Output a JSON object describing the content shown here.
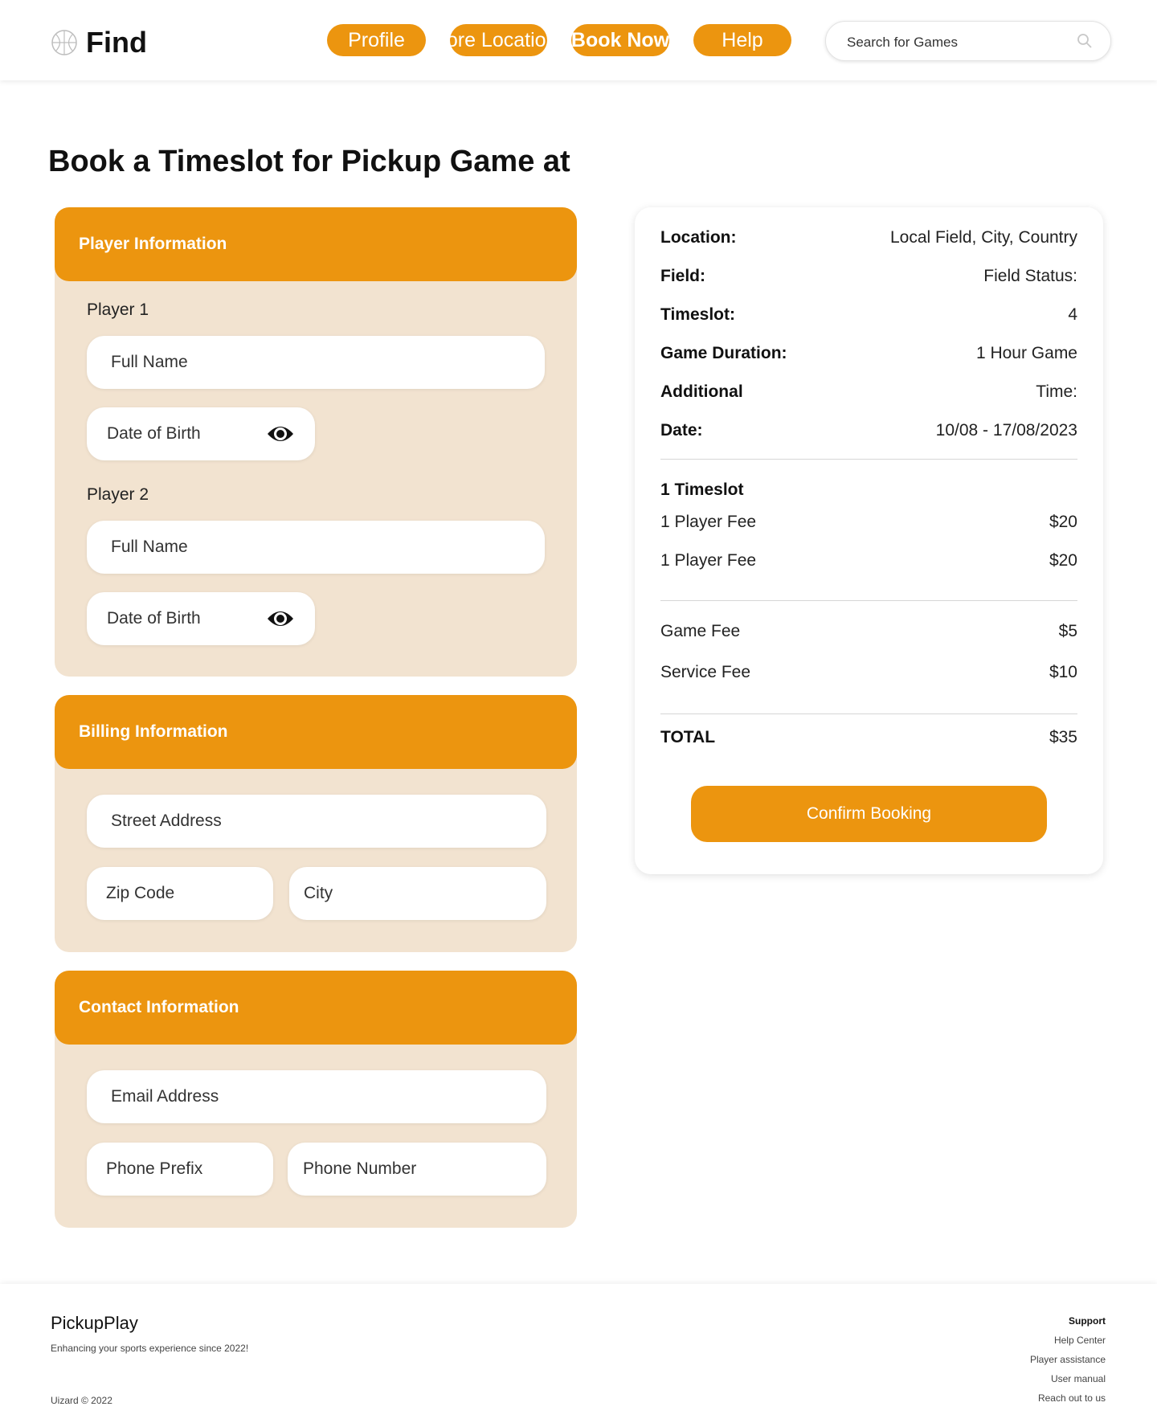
{
  "header": {
    "brand": "Find",
    "nav": {
      "profile": "Profile",
      "more_locations": "More Locations",
      "book_now": "Book Now",
      "help": "Help"
    },
    "search_placeholder": "Search for Games",
    "accent_color": "#ec950f"
  },
  "page_title": "Book a Timeslot for Pickup Game at",
  "player_info": {
    "heading": "Player Information",
    "players": [
      {
        "label": "Player 1",
        "full_name": "Full Name",
        "dob": "Date of Birth"
      },
      {
        "label": "Player 2",
        "full_name": "Full Name",
        "dob": "Date of Birth"
      }
    ]
  },
  "billing_info": {
    "heading": "Billing Information",
    "street": "Street Address",
    "zip": "Zip Code",
    "city": "City"
  },
  "contact_info": {
    "heading": "Contact Information",
    "email": "Email Address",
    "phone_prefix": "Phone Prefix",
    "phone_number": "Phone Number"
  },
  "summary": {
    "location_label": "Location:",
    "location_value": "Local Field, City, Country",
    "field_label": "Field:",
    "field_value": "Field Status:",
    "timeslot_label": "Timeslot:",
    "timeslot_value": "4",
    "duration_label": "Game Duration:",
    "duration_value": "1 Hour Game",
    "additional_label": "Additional",
    "additional_value": "Time:",
    "date_label": "Date:",
    "date_value": "10/08 - 17/08/2023",
    "timeslot_count": "1 Timeslot",
    "player_fees": [
      {
        "label": "1 Player Fee",
        "value": "$20"
      },
      {
        "label": "1 Player Fee",
        "value": "$20"
      }
    ],
    "game_fee_label": "Game Fee",
    "game_fee_value": "$5",
    "service_fee_label": "Service Fee",
    "service_fee_value": "$10",
    "total_label": "TOTAL",
    "total_value": "$35",
    "confirm_label": "Confirm Booking"
  },
  "footer": {
    "brand": "PickupPlay",
    "tagline": "Enhancing your sports experience since 2022!",
    "copyright": "Uizard © 2022",
    "support_heading": "Support",
    "links": [
      "Help Center",
      "Player assistance",
      "User manual",
      "Reach out to us"
    ]
  }
}
